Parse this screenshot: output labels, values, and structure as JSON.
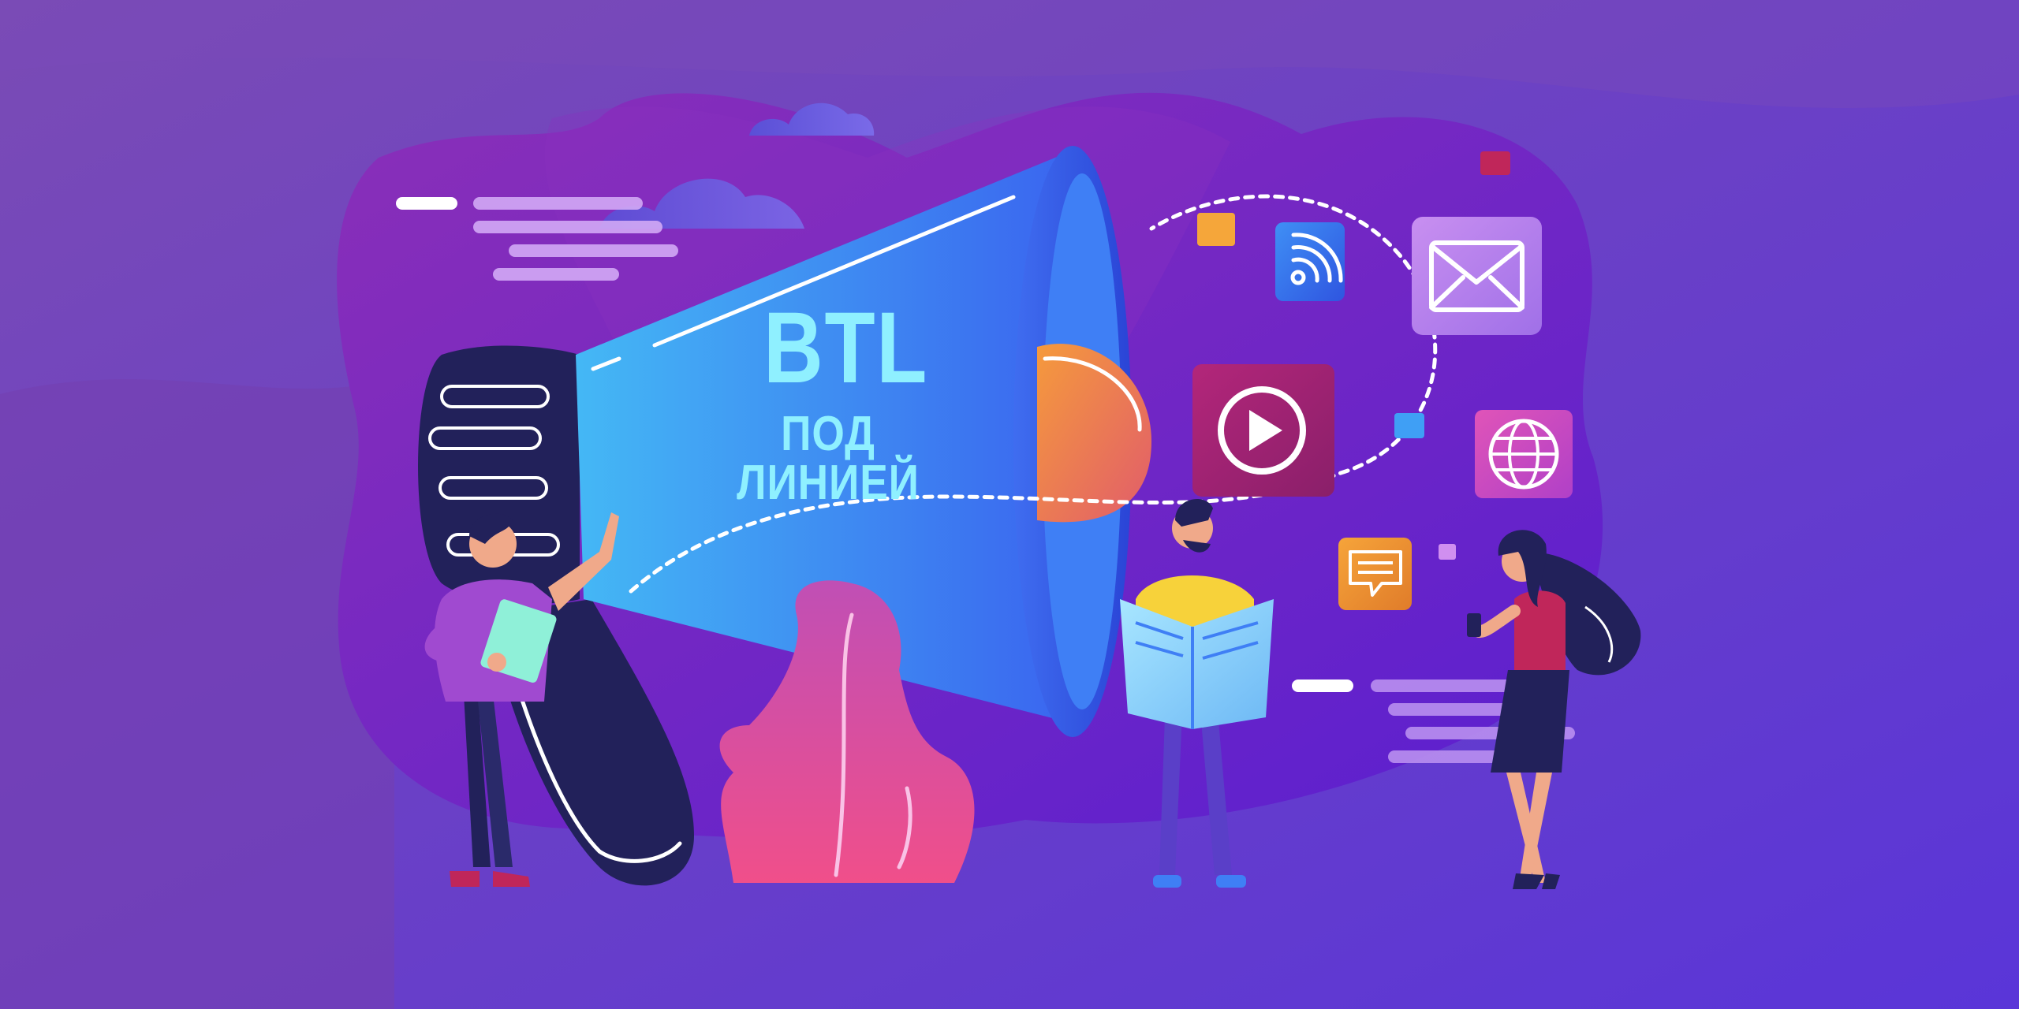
{
  "headline": {
    "title": "BTL",
    "subtitle": "ПОД ЛИНИЕЙ"
  },
  "colors": {
    "background": "#6a3fb5",
    "megaphone_cone": "#3d8ff0",
    "headline_text": "#8ff0ff",
    "accent_orange": "#f0923a",
    "accent_pink": "#e54f9a"
  },
  "icons": [
    "wifi-icon",
    "mail-icon",
    "play-icon",
    "globe-icon",
    "chat-icon"
  ]
}
